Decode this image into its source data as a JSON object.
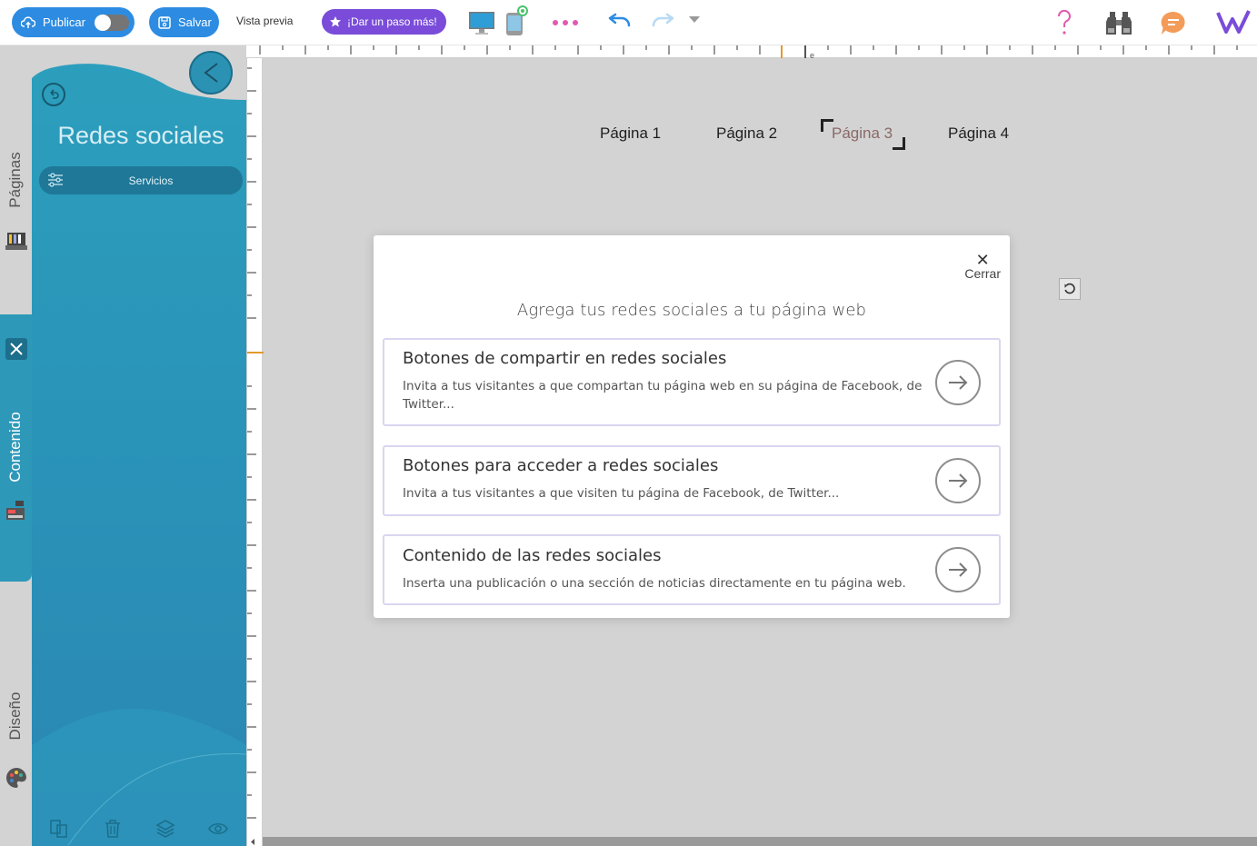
{
  "toolbar": {
    "publish_label": "Publicar",
    "save_label": "Salvar",
    "preview_label": "Vista previa",
    "upgrade_label": "¡Dar un paso más!"
  },
  "sidetabs": {
    "pages": "Páginas",
    "content": "Contenido",
    "design": "Diseño"
  },
  "panel": {
    "title": "Redes sociales",
    "item_label": "Servicios"
  },
  "canvas": {
    "nav": [
      "Página 1",
      "Página 2",
      "Página 3",
      "Página 4"
    ],
    "active_nav": "Página 3",
    "ruler_marker": "e"
  },
  "modal": {
    "close_label": "Cerrar",
    "heading": "Agrega tus redes sociales a tu página web",
    "options": [
      {
        "title": "Botones de compartir en redes sociales",
        "description": "Invita a tus visitantes a que compartan tu página web en su página de Facebook, de Twitter..."
      },
      {
        "title": "Botones para acceder a redes sociales",
        "description": "Invita a tus visitantes a que visiten tu página de Facebook, de Twitter..."
      },
      {
        "title": "Contenido de las redes sociales",
        "description": "Inserta una publicación o una sección de noticias directamente en tu página web."
      }
    ]
  },
  "colors": {
    "primary": "#2d8ce2",
    "upgrade": "#7a4cd9",
    "panel": "#2a93b8",
    "help": "#e05ab0",
    "chat": "#f39c5a",
    "logo": "#7a4cd9"
  }
}
